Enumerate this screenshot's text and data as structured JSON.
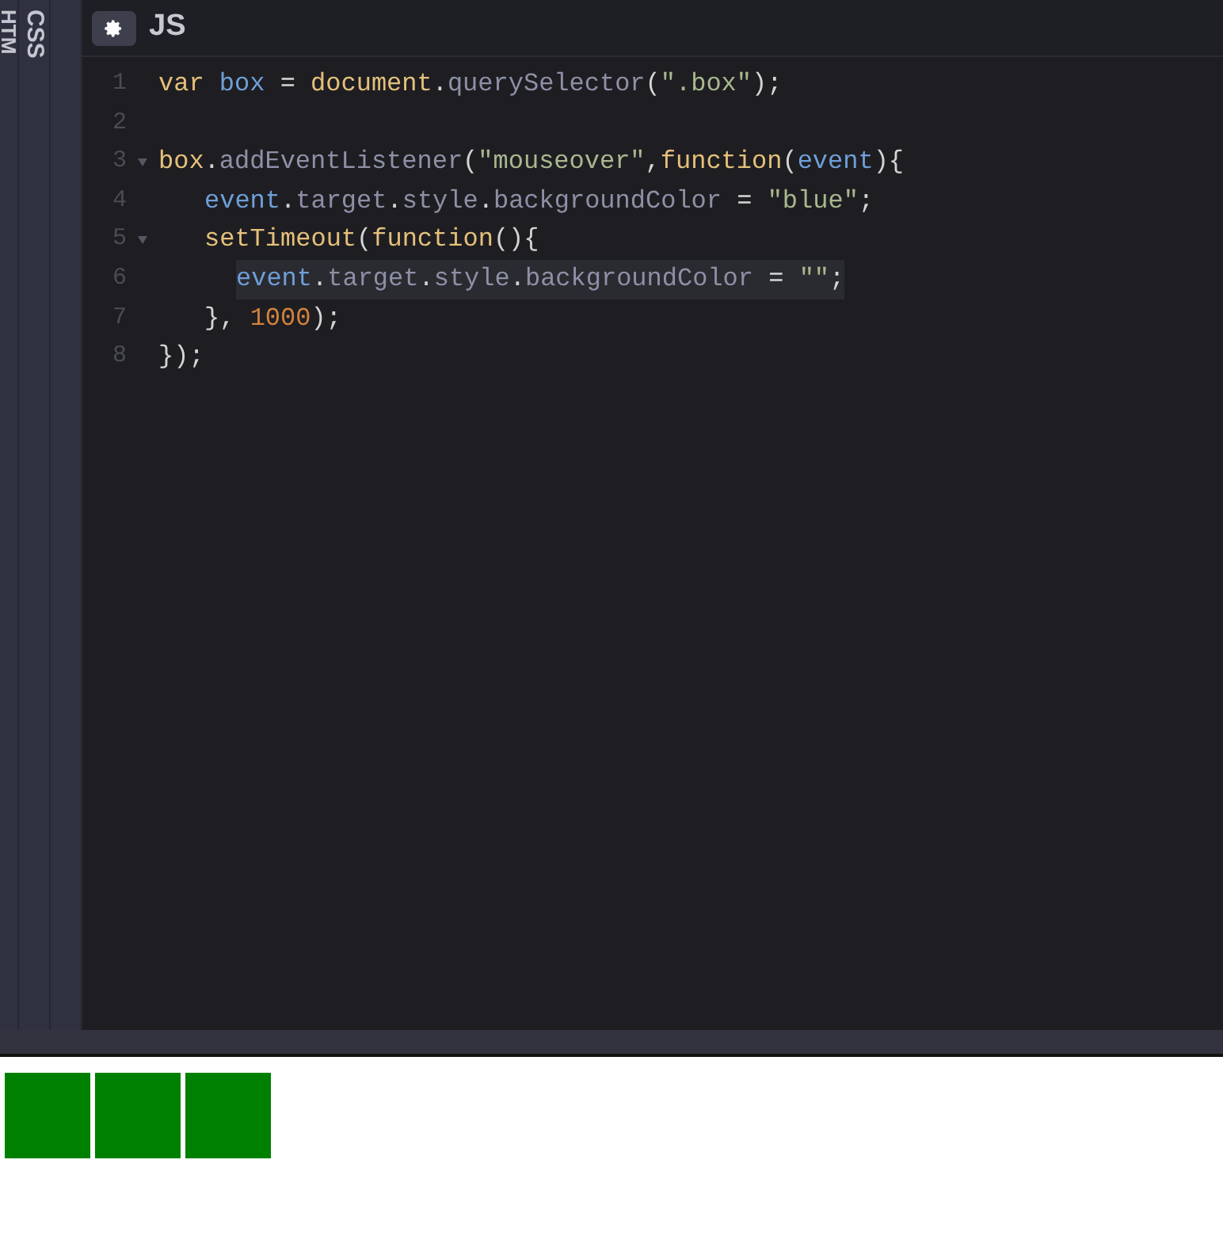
{
  "side_tabs": [
    {
      "label": "HTM"
    },
    {
      "label": "CSS"
    }
  ],
  "editor": {
    "title": "JS",
    "lines": [
      {
        "number": "1",
        "tokens": [
          {
            "kind": "keyword",
            "text": "var "
          },
          {
            "kind": "variable",
            "text": "box"
          },
          {
            "kind": "plain",
            "text": " = "
          },
          {
            "kind": "keyword",
            "text": "document"
          },
          {
            "kind": "plain",
            "text": "."
          },
          {
            "kind": "property",
            "text": "querySelector"
          },
          {
            "kind": "plain",
            "text": "("
          },
          {
            "kind": "string",
            "text": "\".box\""
          },
          {
            "kind": "plain",
            "text": ");"
          }
        ]
      },
      {
        "number": "2"
      },
      {
        "number": "3",
        "foldable": true,
        "tokens": [
          {
            "kind": "keyword",
            "text": "box"
          },
          {
            "kind": "plain",
            "text": "."
          },
          {
            "kind": "property",
            "text": "addEventListener"
          },
          {
            "kind": "plain",
            "text": "("
          },
          {
            "kind": "string",
            "text": "\"mouseover\""
          },
          {
            "kind": "plain",
            "text": ","
          },
          {
            "kind": "keyword",
            "text": "function"
          },
          {
            "kind": "plain",
            "text": "("
          },
          {
            "kind": "variable",
            "text": "event"
          },
          {
            "kind": "plain",
            "text": "){"
          }
        ],
        "children": [
          {
            "number": "4",
            "tokens": [
              {
                "kind": "variable",
                "text": "event"
              },
              {
                "kind": "plain",
                "text": "."
              },
              {
                "kind": "property",
                "text": "target"
              },
              {
                "kind": "plain",
                "text": "."
              },
              {
                "kind": "property",
                "text": "style"
              },
              {
                "kind": "plain",
                "text": "."
              },
              {
                "kind": "property",
                "text": "backgroundColor"
              },
              {
                "kind": "plain",
                "text": " = "
              },
              {
                "kind": "string",
                "text": "\"blue\""
              },
              {
                "kind": "plain",
                "text": ";"
              }
            ]
          },
          {
            "number": "5",
            "foldable": true,
            "tokens": [
              {
                "kind": "keyword",
                "text": "setTimeout"
              },
              {
                "kind": "plain",
                "text": "("
              },
              {
                "kind": "keyword",
                "text": "function"
              },
              {
                "kind": "plain",
                "text": "(){"
              }
            ],
            "children": [
              {
                "number": "6",
                "highlighted": true,
                "tokens": [
                  {
                    "kind": "variable",
                    "text": "event"
                  },
                  {
                    "kind": "plain",
                    "text": "."
                  },
                  {
                    "kind": "property",
                    "text": "target"
                  },
                  {
                    "kind": "plain",
                    "text": "."
                  },
                  {
                    "kind": "property",
                    "text": "style"
                  },
                  {
                    "kind": "plain",
                    "text": "."
                  },
                  {
                    "kind": "property",
                    "text": "backgroundColor"
                  },
                  {
                    "kind": "plain",
                    "text": " = "
                  },
                  {
                    "kind": "string",
                    "text": "\"\""
                  },
                  {
                    "kind": "plain",
                    "text": ";"
                  }
                ]
              }
            ]
          },
          {
            "number": "7",
            "tokens": [
              {
                "kind": "plain",
                "text": "}, "
              },
              {
                "kind": "number",
                "text": "1000"
              },
              {
                "kind": "plain",
                "text": ");"
              }
            ]
          }
        ]
      },
      {
        "number": "8",
        "tokens": [
          {
            "kind": "plain",
            "text": "});"
          }
        ]
      }
    ]
  },
  "preview": {
    "boxes": [
      {
        "color": "#008000"
      },
      {
        "color": "#008000"
      },
      {
        "color": "#008000"
      }
    ]
  }
}
